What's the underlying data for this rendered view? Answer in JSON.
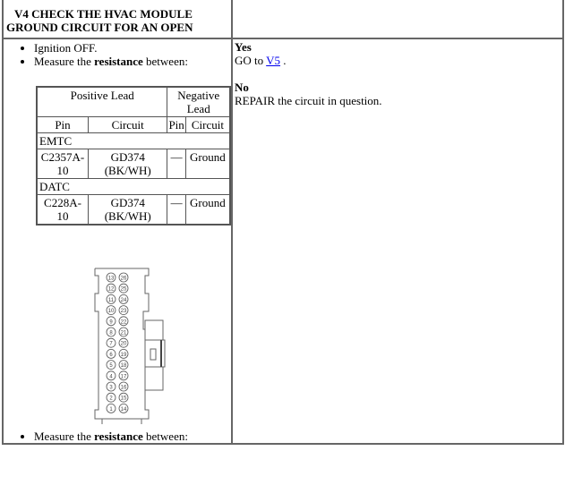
{
  "step": {
    "title_line1": "V4 CHECK THE HVAC MODULE",
    "title_line2": "GROUND CIRCUIT FOR AN OPEN"
  },
  "instructions": {
    "items": [
      "Ignition OFF.",
      "Measure the resistance between:"
    ],
    "measure_prefix": "Measure the ",
    "measure_bold": "resistance",
    "measure_suffix": " between:"
  },
  "pin_table": {
    "headers": {
      "positive_lead": "Positive Lead",
      "negative_lead": "Negative Lead",
      "pin": "Pin",
      "circuit": "Circuit"
    },
    "sections": [
      {
        "name": "EMTC",
        "rows": [
          {
            "pos_pin": "C2357A-10",
            "pos_circuit": "GD374 (BK/WH)",
            "neg_pin": "—",
            "neg_circuit": "Ground"
          }
        ]
      },
      {
        "name": "DATC",
        "rows": [
          {
            "pos_pin": "C228A-10",
            "pos_circuit": "GD374 (BK/WH)",
            "neg_pin": "—",
            "neg_circuit": "Ground"
          }
        ]
      }
    ]
  },
  "connector": {
    "left_column_pins": [
      "13",
      "12",
      "11",
      "10",
      "9",
      "8",
      "7",
      "6",
      "5",
      "4",
      "3",
      "2",
      "1"
    ],
    "right_column_pins": [
      "26",
      "25",
      "24",
      "23",
      "22",
      "21",
      "20",
      "19",
      "18",
      "17",
      "16",
      "15",
      "14"
    ]
  },
  "results": {
    "yes_label": "Yes",
    "yes_text": "GO to ",
    "yes_link": "V5",
    "yes_suffix": " .",
    "no_label": "No",
    "no_text": "REPAIR the circuit in question."
  },
  "colors": {
    "link": "#0000ee",
    "border": "#666666"
  }
}
